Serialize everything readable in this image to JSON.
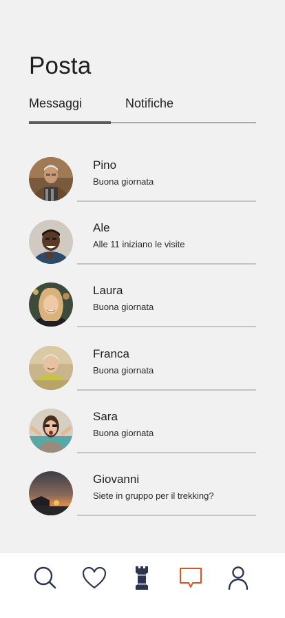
{
  "header": {
    "title": "Posta"
  },
  "tabs": [
    {
      "label": "Messaggi",
      "active": true
    },
    {
      "label": "Notifiche",
      "active": false
    }
  ],
  "messages": [
    {
      "name": "Pino",
      "preview": "Buona giornata"
    },
    {
      "name": "Ale",
      "preview": "Alle 11 iniziano le visite"
    },
    {
      "name": "Laura",
      "preview": "Buona giornata"
    },
    {
      "name": "Franca",
      "preview": "Buona giornata"
    },
    {
      "name": "Sara",
      "preview": "Buona giornata"
    },
    {
      "name": "Giovanni",
      "preview": "Siete in gruppo per il trekking?"
    }
  ],
  "bottom_nav": [
    {
      "icon": "search-icon",
      "active": false
    },
    {
      "icon": "heart-icon",
      "active": false
    },
    {
      "icon": "tower-icon",
      "active": false
    },
    {
      "icon": "chat-icon",
      "active": true
    },
    {
      "icon": "user-icon",
      "active": false
    }
  ],
  "colors": {
    "background": "#f1f1f1",
    "nav_icon": "#2b3550",
    "nav_active": "#d9541e",
    "tab_indicator": "#5c5c5c"
  }
}
